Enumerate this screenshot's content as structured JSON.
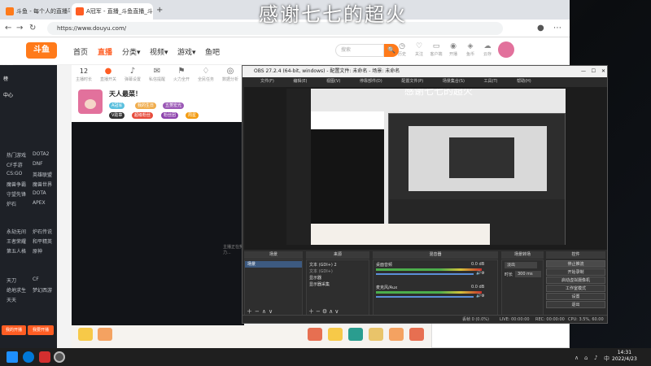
{
  "overlay_text": "感谢七七的超火",
  "browser": {
    "tabs": [
      {
        "label": "斗鱼 - 每个人的直播平台"
      },
      {
        "label": "A冠军 - 直播_斗鱼直播_斗鱼"
      }
    ],
    "url": "https://www.douyu.com/"
  },
  "douyu": {
    "logo": "斗鱼",
    "nav": [
      "首页",
      "直播",
      "分类▾",
      "视频▾",
      "游戏▾",
      "鱼吧"
    ],
    "search_placeholder": "搜索",
    "search_icon": "🔍",
    "top_icons": [
      "历史",
      "关注",
      "客户端",
      "开播",
      "鱼币",
      "云存"
    ],
    "stats": [
      {
        "icon": "12",
        "label": "主播时长"
      },
      {
        "icon": "●",
        "label": "直播开关"
      },
      {
        "icon": "♪",
        "label": "弹幕设置"
      },
      {
        "icon": "✉",
        "label": "私信提醒"
      },
      {
        "icon": "⚑",
        "label": "火力全开"
      },
      {
        "icon": "♢",
        "label": "全民任务"
      },
      {
        "icon": "◎",
        "label": "数据分析"
      }
    ],
    "streamer_name": "天人最菜！",
    "tags": [
      "A冠军",
      "我的生日",
      "五菱宏光"
    ],
    "badges": [
      "V勋章",
      "超级粉丝",
      "粉丝团",
      "周星"
    ],
    "stage_caption": "主播正在努力..."
  },
  "sidebar": {
    "items": [
      "关注",
      "榜",
      "中心",
      "热门游戏",
      "DOTA2",
      "CF手游",
      "DNF",
      "CS:GO",
      "英雄联盟",
      "魔兽争霸",
      "魔兽世界",
      "守望先锋",
      "DOTA",
      "炉石",
      "APEX",
      "永劫无间",
      "炉石传说",
      "王者荣耀",
      "和平精英",
      "第五人格",
      "原神",
      "天刀",
      "CF",
      "绝地求生",
      "梦幻西游",
      "天天"
    ],
    "buttons": [
      "我的开播",
      "我要开播"
    ]
  },
  "obs": {
    "title": "OBS 27.2.4 (64-bit, windows) - 配置文件: 未命名 - 场景: 未命名",
    "menu": [
      "文件(F)",
      "编辑(E)",
      "视图(V)",
      "停靠部件(D)",
      "配置文件(P)",
      "场景集合(S)",
      "工具(T)",
      "帮助(H)"
    ],
    "panels": {
      "scenes": "场景",
      "sources": "来源",
      "mixer": "混音器",
      "transitions": "场景转场",
      "controls": "控件"
    },
    "scene_item": "场景",
    "sources_list": [
      "文本 (GDI+) 2",
      "文本 (GDI+)",
      "显示器",
      "显示器采集"
    ],
    "mixer_tracks": [
      {
        "name": "桌面音频",
        "db": "0.0 dB"
      },
      {
        "name": "麦克风/Aux",
        "db": "0.0 dB"
      }
    ],
    "transition": "淡出",
    "duration_label": "时长",
    "duration": "300 ms",
    "control_buttons": [
      "停止推流",
      "开始录制",
      "启动虚拟摄像机",
      "工作室模式",
      "设置",
      "退出"
    ],
    "status": {
      "dropped": "丢帧 0 (0.0%)",
      "live": "LIVE: 00:00:00",
      "rec": "REC: 00:00:00",
      "cpu": "CPU: 3.5%, 60.00 fps"
    },
    "source_label": "来选择源"
  },
  "taskbar": {
    "time": "14:31",
    "date": "2022/4/23"
  }
}
